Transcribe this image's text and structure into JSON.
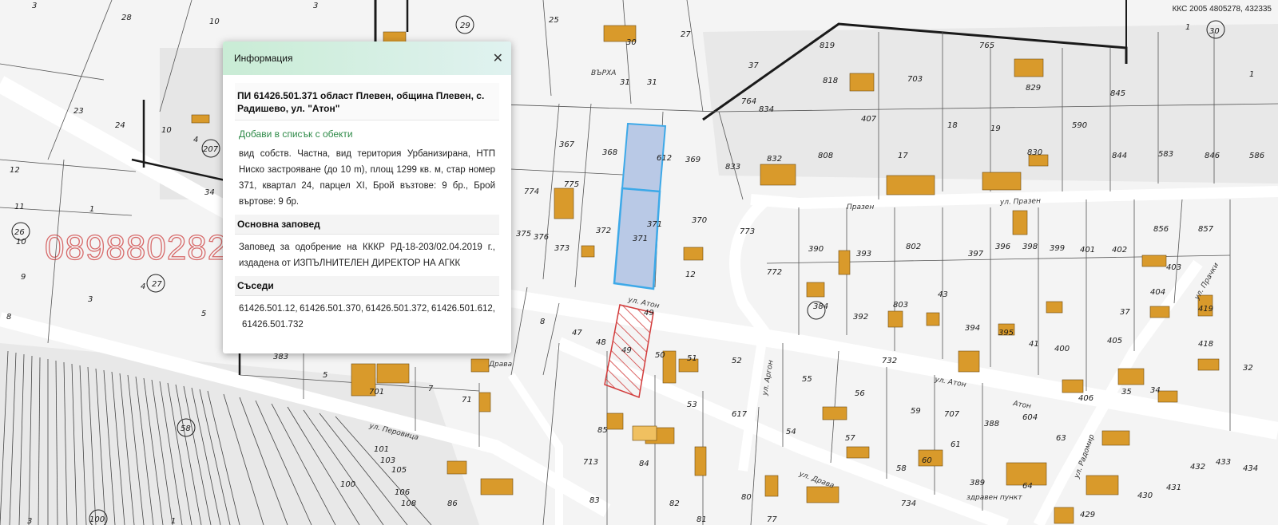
{
  "map": {
    "coordinates_readout": "ККС 2005 4805278, 432335",
    "watermark_phone": "0898802828",
    "streets": [
      "ул. Атон",
      "Атон",
      "ул. Празен",
      "Празен",
      "ул. Драва",
      "Драва",
      "ул. Перовица",
      "ул. Радомир",
      "ул. Аргон",
      "ул. Прачки"
    ],
    "place_labels": [
      "ВЪРХА",
      "здравен пункт"
    ],
    "parcel_numbers": [
      "28",
      "10",
      "25",
      "29",
      "30",
      "27",
      "37",
      "31",
      "31",
      "23",
      "24",
      "10",
      "207",
      "4",
      "12",
      "34",
      "11",
      "1",
      "26",
      "10",
      "9",
      "3",
      "4",
      "27",
      "5",
      "8",
      "383",
      "5",
      "701",
      "7",
      "71",
      "819",
      "765",
      "818",
      "703",
      "407",
      "18",
      "19",
      "829",
      "590",
      "845",
      "764",
      "834",
      "832",
      "808",
      "17",
      "830",
      "844",
      "583",
      "846",
      "586",
      "367",
      "368",
      "612",
      "369",
      "833",
      "775",
      "774",
      "375",
      "376",
      "373",
      "372",
      "371",
      "371",
      "370",
      "773",
      "12",
      "772",
      "390",
      "393",
      "802",
      "397",
      "396",
      "398",
      "399",
      "401",
      "402",
      "856",
      "857",
      "403",
      "384",
      "392",
      "803",
      "43",
      "394",
      "395",
      "41",
      "400",
      "405",
      "37",
      "404",
      "419",
      "418",
      "32",
      "49",
      "48",
      "47",
      "50",
      "51",
      "52",
      "55",
      "56",
      "732",
      "59",
      "707",
      "604",
      "63",
      "406",
      "35",
      "34",
      "53",
      "617",
      "54",
      "57",
      "58",
      "61",
      "60",
      "388",
      "389",
      "64",
      "430",
      "431",
      "432",
      "433",
      "434",
      "85",
      "84",
      "713",
      "83",
      "82",
      "81",
      "80",
      "77",
      "86",
      "734",
      "101",
      "103",
      "105",
      "106",
      "108",
      "100",
      "1",
      "3",
      "429",
      "30",
      "1"
    ]
  },
  "panel": {
    "header_title": "Информация",
    "close_icon": "close-icon",
    "parcel_title": "ПИ 61426.501.371 област Плевен, община Плевен, с. Радишево, ул. \"Атон\"",
    "add_link": "Добави в списък с обекти",
    "description": "вид собств. Частна, вид територия Урбанизирана, НТП Ниско застрояване (до 10 m), площ 1299 кв. м, стар номер 371, квартал 24, парцел XI, Брой възтове: 9 бр., Брой въртове: 9 бр.",
    "order_heading": "Основна заповед",
    "order_text": "Заповед за одобрение на КККР РД-18-203/02.04.2019 г., издадена от ИЗПЪЛНИТЕЛЕН ДИРЕКТОР НА АГКК",
    "neighbors_heading": "Съседи",
    "neighbors": [
      "61426.501.12,",
      "61426.501.370,",
      "61426.501.372,",
      "61426.501.612,",
      "61426.501.732"
    ]
  },
  "colors": {
    "selected_parcel_fill": "#b9c9e6",
    "selected_parcel_stroke": "#3da9e8",
    "building_fill": "#d99a2b",
    "hatch_color": "#d23a3a",
    "road_fill": "#ffffff",
    "parcel_line": "#555555"
  }
}
